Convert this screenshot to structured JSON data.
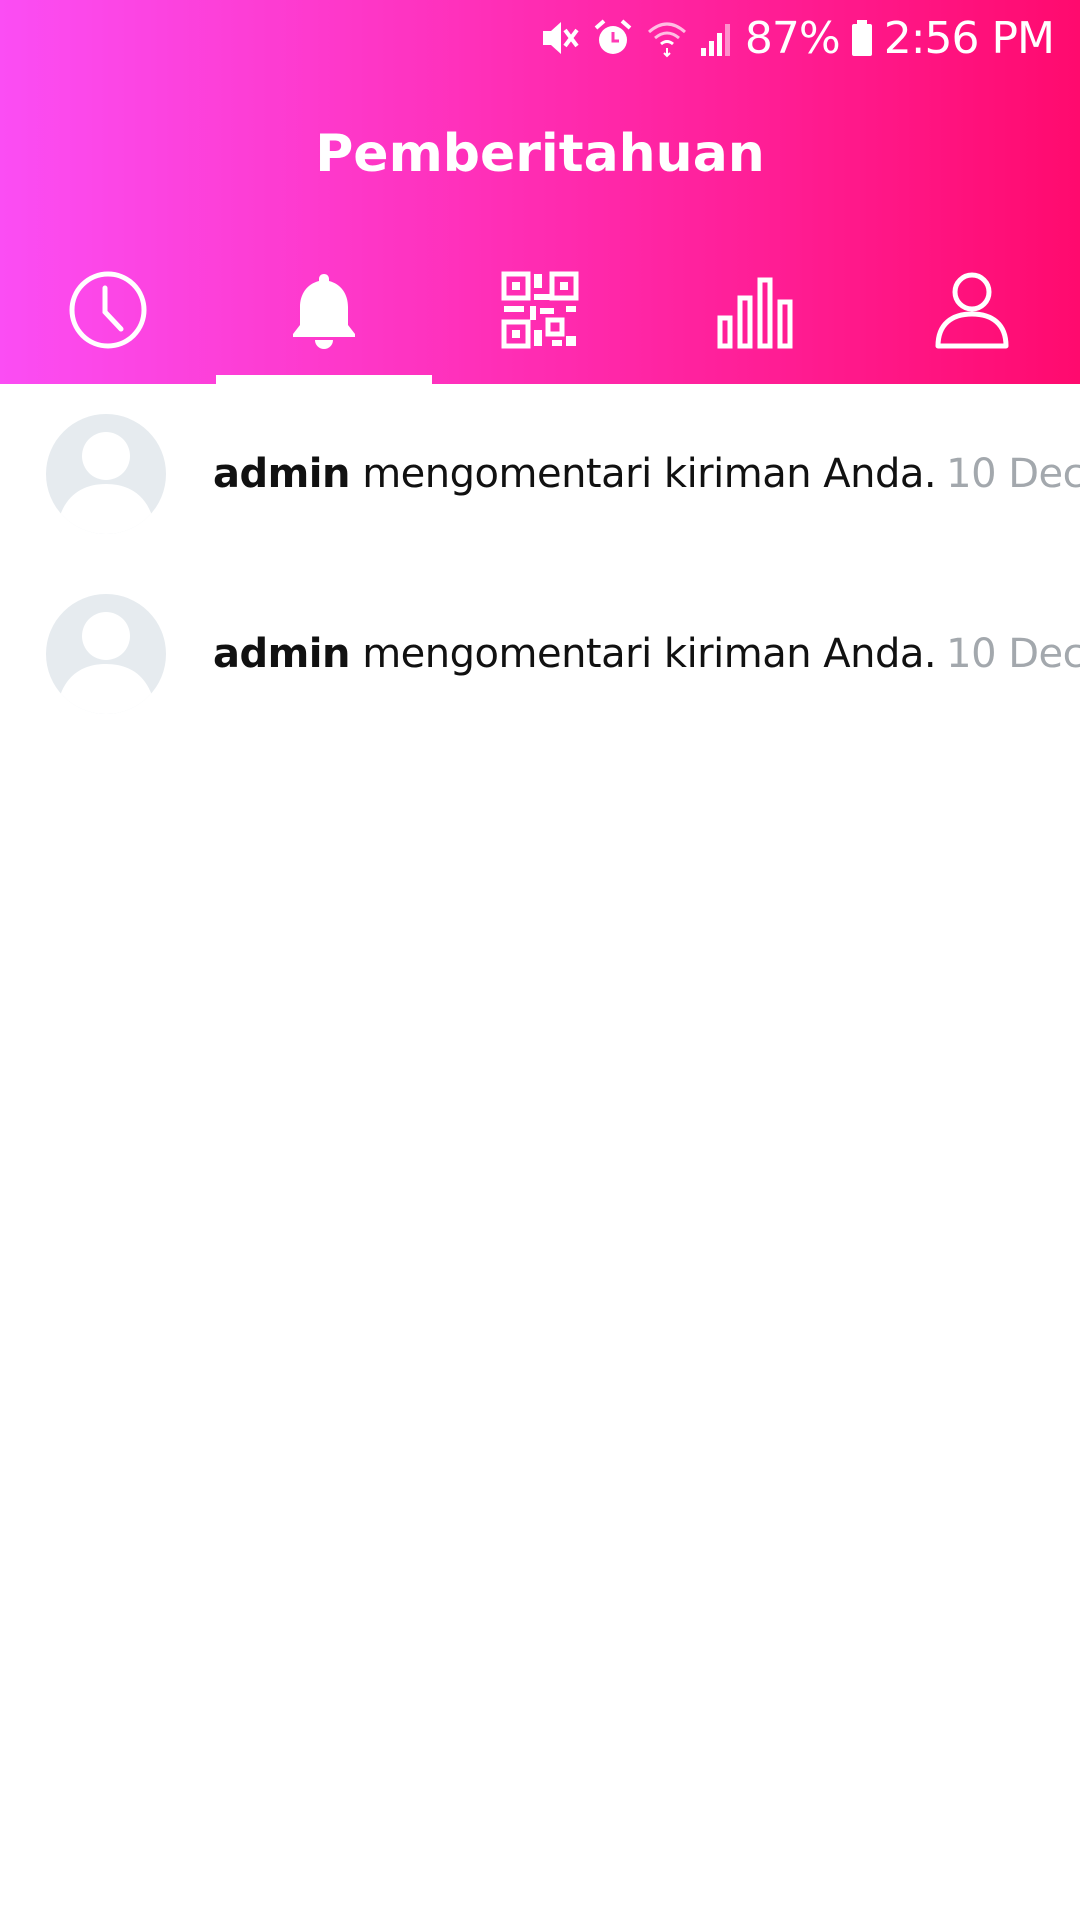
{
  "status_bar": {
    "battery": "87%",
    "time": "2:56 PM",
    "icons": [
      "mute-icon",
      "alarm-icon",
      "wifi-icon",
      "signal-icon",
      "battery-icon"
    ]
  },
  "header": {
    "title": "Pemberitahuan",
    "gradient": [
      "#fb4df4",
      "#ff0a6e"
    ]
  },
  "tabs": [
    {
      "name": "history",
      "icon": "clock-icon"
    },
    {
      "name": "notifications",
      "icon": "bell-icon",
      "active": true
    },
    {
      "name": "scan",
      "icon": "qr-code-icon"
    },
    {
      "name": "stats",
      "icon": "bar-chart-icon"
    },
    {
      "name": "profile",
      "icon": "user-icon"
    }
  ],
  "notifications": [
    {
      "user": "admin",
      "message": "mengomentari kiriman Anda.",
      "time": "10 Dec"
    },
    {
      "user": "admin",
      "message": "mengomentari kiriman Anda.",
      "time": "10 Dec"
    }
  ]
}
